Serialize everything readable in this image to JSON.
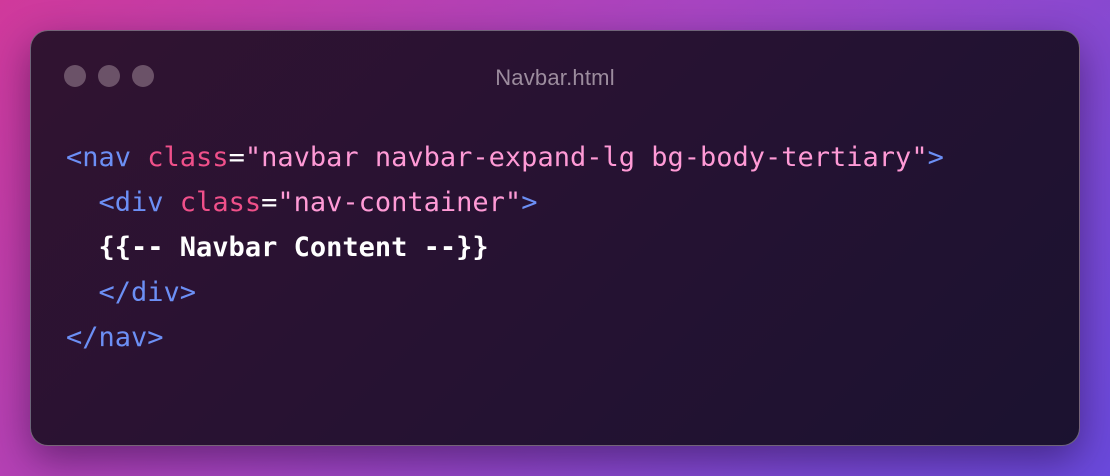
{
  "window": {
    "title": "Navbar.html"
  },
  "code": {
    "line1": {
      "open": "<nav",
      "attr": " class",
      "eq": "=",
      "value": "\"navbar navbar-expand-lg bg-body-tertiary\"",
      "close": ">"
    },
    "line2": {
      "indent": "  ",
      "open": "<div",
      "attr": " class",
      "eq": "=",
      "value": "\"nav-container\"",
      "close": ">"
    },
    "line3": {
      "indent": "  ",
      "text": "{{-- Navbar Content --}}"
    },
    "line4": {
      "indent": "  ",
      "tag": "</div>"
    },
    "line5": {
      "tag": "</nav>"
    }
  },
  "colors": {
    "tag": "#6c8ff5",
    "attribute": "#f0508a",
    "string": "#ff9ad6",
    "plain": "#ffffff",
    "title": "#9c8c9e"
  }
}
